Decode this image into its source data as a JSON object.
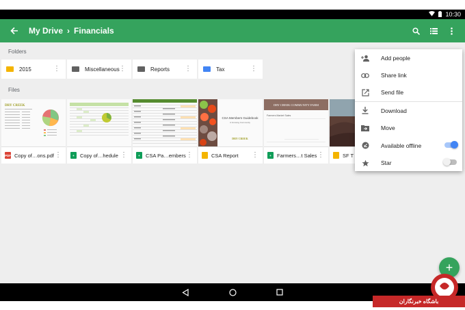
{
  "status_bar": {
    "time": "10:30"
  },
  "app_bar": {
    "breadcrumb": [
      "My Drive",
      "Financials"
    ],
    "separator": "›",
    "color": "#35a35d"
  },
  "folders_section": {
    "label": "Folders",
    "items": [
      {
        "name": "2015",
        "icon": "folder-icon",
        "color": "#f4b400"
      },
      {
        "name": "Miscellaneous",
        "icon": "shared-folder-icon",
        "color": "#616161"
      },
      {
        "name": "Reports",
        "icon": "shared-folder-icon",
        "color": "#616161"
      },
      {
        "name": "Tax",
        "icon": "shared-folder-icon",
        "color": "#4285f4"
      }
    ]
  },
  "files_section": {
    "label": "Files",
    "items": [
      {
        "name": "Copy of…ons.pdf",
        "type": "pdf",
        "badge": "PDF",
        "color": "#db4437"
      },
      {
        "name": "Copy of…hedule",
        "type": "sheets",
        "color": "#0f9d58"
      },
      {
        "name": "CSA Pa…embers",
        "type": "sheets",
        "color": "#0f9d58"
      },
      {
        "name": "CSA Report",
        "type": "slides",
        "color": "#f4b400"
      },
      {
        "name": "Farmers…t Sales",
        "type": "sheets",
        "color": "#0f9d58"
      },
      {
        "name": "SF T",
        "type": "slides",
        "color": "#f4b400"
      }
    ],
    "thumb_text": {
      "dry_creek_1": "DRY CREEK",
      "csa_title_1": "CSA Members Guidebook",
      "csa_title_2": "A Growing Community",
      "dry_creek_2": "DRY CREEK",
      "farm_banner": "DRY CREEK COMMUNITY FARM",
      "farm_sub": "Farmers Market Sales"
    }
  },
  "context_menu": {
    "items": [
      {
        "label": "Add people",
        "icon": "add-person-icon"
      },
      {
        "label": "Share link",
        "icon": "link-icon"
      },
      {
        "label": "Send file",
        "icon": "send-file-icon"
      },
      {
        "label": "Download",
        "icon": "download-icon"
      },
      {
        "label": "Move",
        "icon": "move-folder-icon"
      },
      {
        "label": "Available offline",
        "icon": "offline-pin-icon",
        "toggle": true,
        "on": true
      },
      {
        "label": "Star",
        "icon": "star-icon",
        "toggle": true,
        "on": false
      }
    ],
    "toggle_on_color": "#4285f4"
  },
  "fab": {
    "label": "+"
  },
  "watermark": {
    "text": "باشگاه خبرنگاران"
  }
}
